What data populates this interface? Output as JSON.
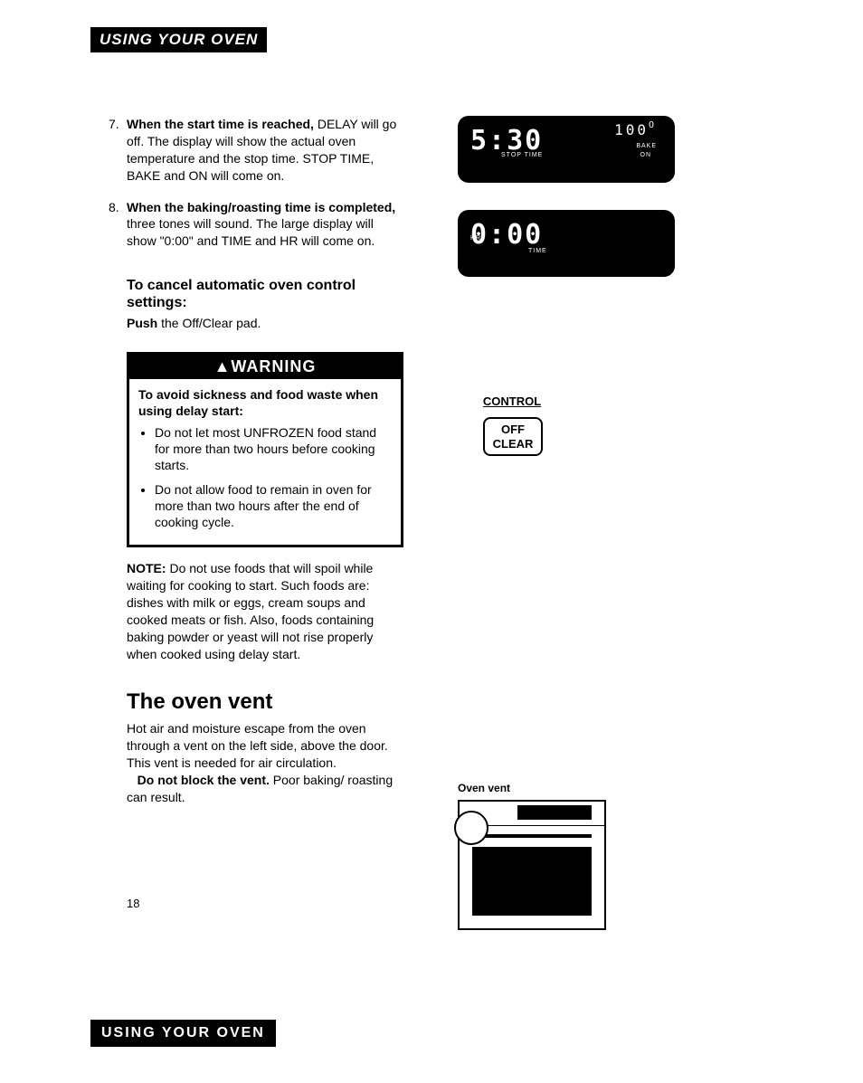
{
  "header": "USING YOUR OVEN",
  "steps": {
    "s7": {
      "num": "7.",
      "bold": "When the start time is reached,",
      "text": " DELAY will go off. The display will show the actual oven temperature and the stop time. STOP TIME, BAKE and ON will come on."
    },
    "s8": {
      "num": "8.",
      "bold": "When the baking/roasting time is completed,",
      "text": " three tones will sound. The large display will show \"0:00\" and TIME and HR will come on."
    }
  },
  "cancel": {
    "heading": "To cancel automatic oven control settings:",
    "body_bold": "Push",
    "body_rest": " the Off/Clear pad."
  },
  "warning": {
    "title": "WARNING",
    "intro": "To avoid sickness and food waste when using delay start:",
    "bullet1": "Do not let most UNFROZEN food stand for more than two hours before cooking starts.",
    "bullet2": "Do not allow food to remain in oven for more than two hours after the end of cooking cycle."
  },
  "note": {
    "label": "NOTE:",
    "text": " Do not use foods that will spoil while waiting for cooking to start. Such foods are: dishes with milk or eggs, cream soups and cooked meats or fish. Also, foods containing baking powder or yeast will not rise properly when cooked using delay start."
  },
  "vent": {
    "title": "The oven vent",
    "p1": "Hot air and moisture escape from the oven through a vent on the left side, above the door. This vent is needed for air circulation.",
    "p2_bold": "Do not block the vent.",
    "p2_rest": " Poor baking/ roasting can result.",
    "label": "Oven vent"
  },
  "displays": {
    "d1": {
      "time": "5:30",
      "time_label": "STOP TIME",
      "temp": "100",
      "bake": "BAKE",
      "on": "ON"
    },
    "d2": {
      "time": "0:00",
      "hr": "HR",
      "time_label": "TIME"
    }
  },
  "control": {
    "label": "CONTROL",
    "btn1": "OFF",
    "btn2": "CLEAR"
  },
  "page_number": "18",
  "footer": "USING YOUR OVEN"
}
